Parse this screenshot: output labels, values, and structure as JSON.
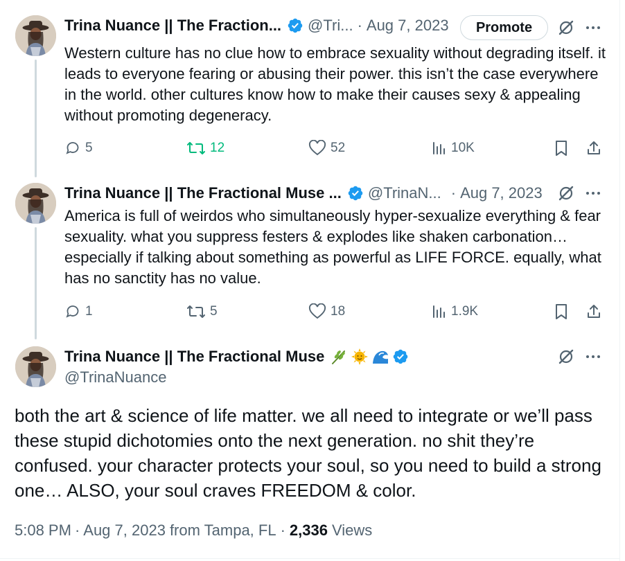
{
  "colors": {
    "text_primary": "#0f1419",
    "text_secondary": "#536471",
    "verified_blue": "#1d9bf0",
    "retweet_green": "#00ba7c",
    "border": "#cfd9de"
  },
  "tweets": [
    {
      "author_name": "Trina Nuance || The Fraction...",
      "handle": "@Tri...",
      "separator": "·",
      "date": "Aug 7, 2023",
      "promote_label": "Promote",
      "text": "Western culture has no clue how to embrace sexuality without degrading itself. it leads to everyone fearing or abusing their power. this isn’t the case everywhere in the world. other cultures know how to make their causes sexy & appealing without promoting degeneracy.",
      "replies": "5",
      "retweets": "12",
      "retweeted": true,
      "likes": "52",
      "views": "10K",
      "icons": [
        "reply-icon",
        "retweet-icon",
        "like-icon",
        "views-icon",
        "bookmark-icon",
        "share-icon",
        "grok-icon",
        "more-icon",
        "verified-icon"
      ]
    },
    {
      "author_name": "Trina Nuance || The Fractional Muse ...",
      "handle": "@TrinaN...",
      "separator": "·",
      "date": "Aug 7, 2023",
      "text": "America is full of weirdos who simultaneously hyper-sexualize everything & fear sexuality. what you suppress festers & explodes like shaken carbonation… especially if talking about something as powerful as LIFE FORCE. equally, what has no sanctity has no value.",
      "replies": "1",
      "retweets": "5",
      "retweeted": false,
      "likes": "18",
      "views": "1.9K"
    }
  ],
  "main_tweet": {
    "author_name": "Trina Nuance || The Fractional Muse",
    "emojis": [
      "herb-emoji",
      "sun-emoji",
      "wave-emoji"
    ],
    "handle": "@TrinaNuance",
    "text": "both the art & science of life matter. we all need to integrate or we’ll pass these stupid dichotomies onto the next generation. no shit they’re confused. your character protects your soul, so you need to build a strong one… ALSO, your soul craves FREEDOM & color.",
    "time": "5:08 PM",
    "separator": "·",
    "date": "Aug 7, 2023",
    "location": "from Tampa, FL",
    "views_count": "2,336",
    "views_label": "Views"
  }
}
